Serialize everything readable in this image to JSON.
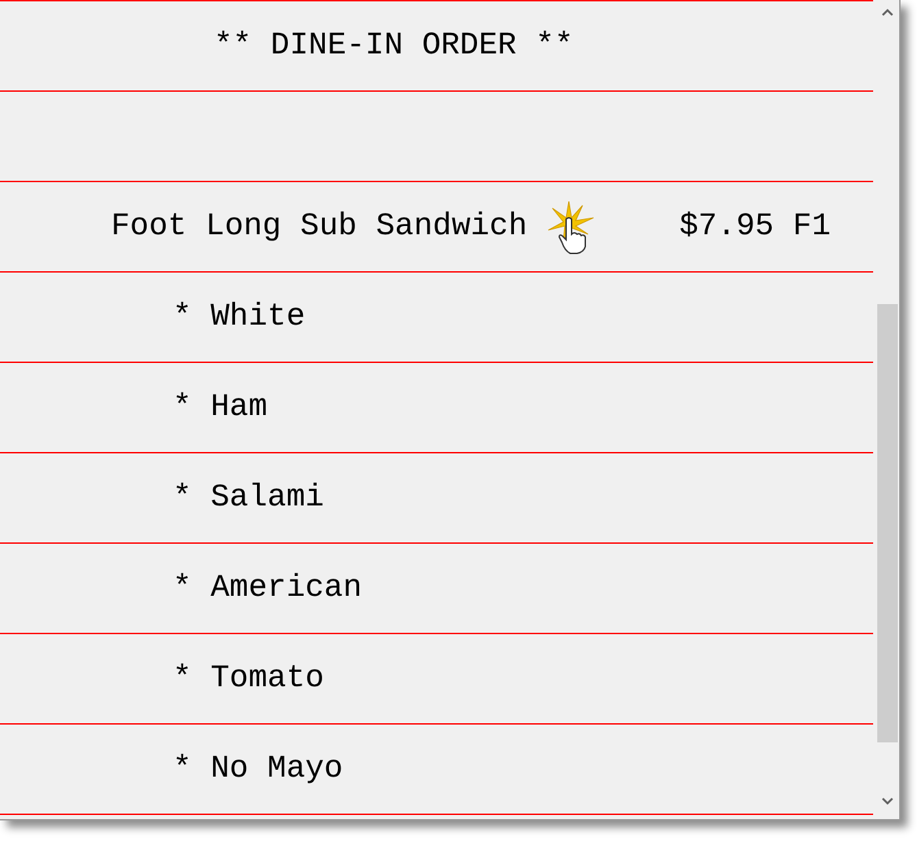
{
  "order_lines": [
    {
      "kind": "header",
      "text": "** DINE-IN ORDER **"
    },
    {
      "kind": "blank"
    },
    {
      "kind": "item",
      "text": "Foot Long Sub Sandwich",
      "price": "$7.95 F1"
    },
    {
      "kind": "modifier",
      "text": "* White"
    },
    {
      "kind": "modifier",
      "text": "* Ham"
    },
    {
      "kind": "modifier",
      "text": "* Salami"
    },
    {
      "kind": "modifier",
      "text": "* American"
    },
    {
      "kind": "modifier",
      "text": "* Tomato"
    },
    {
      "kind": "modifier",
      "text": "* No Mayo"
    }
  ]
}
